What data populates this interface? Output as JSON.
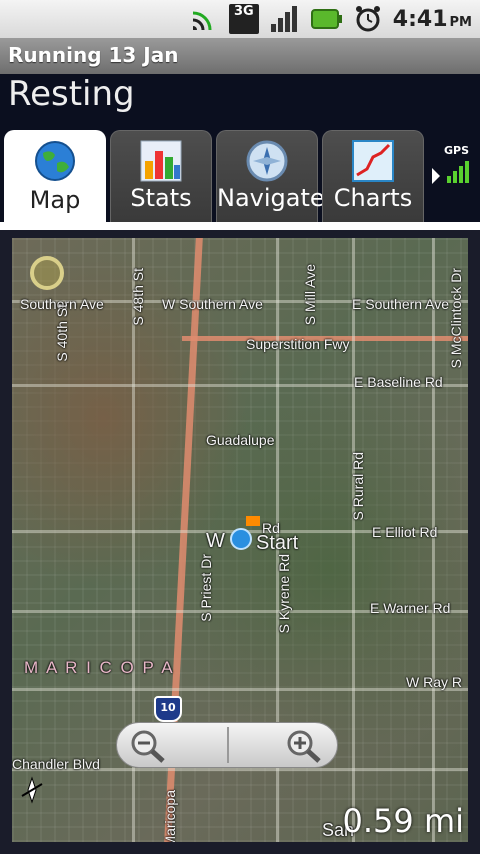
{
  "status_bar": {
    "network": "3G",
    "time": "4:41",
    "ampm": "PM"
  },
  "title_bar": {
    "title": "Running 13 Jan"
  },
  "header": {
    "state": "Resting"
  },
  "tabs": [
    {
      "label": "Map",
      "icon": "globe-icon",
      "active": true
    },
    {
      "label": "Stats",
      "icon": "bar-chart-icon",
      "active": false
    },
    {
      "label": "Navigate",
      "icon": "compass-icon",
      "active": false
    },
    {
      "label": "Charts",
      "icon": "line-chart-icon",
      "active": false
    }
  ],
  "gps": {
    "label": "GPS"
  },
  "map": {
    "labels": {
      "southern_ave_w": "Southern Ave",
      "w_southern_ave": "W Southern Ave",
      "e_southern_ave": "E Southern Ave",
      "superstition_fwy": "Superstition Fwy",
      "e_baseline_rd": "E Baseline Rd",
      "guadalupe": "Guadalupe",
      "e_elliot_rd": "E Elliot Rd",
      "e_warner_rd": "E Warner Rd",
      "w_ray_rd": "W Ray R",
      "chandler_blvd": "Chandler Blvd",
      "s_40th_st": "S 40th St",
      "s_48th_st": "S 48th St",
      "s_priest_dr": "S Priest Dr",
      "s_kyrene_rd": "S Kyrene Rd",
      "s_rural_rd": "S Rural Rd",
      "s_mill_ave": "S Mill Ave",
      "s_mcclintock_dr": "S McClintock Dr",
      "maricopa": "M A R I C O P A",
      "start": "Start",
      "w_elliot": "W",
      "rd": "Rd",
      "san": "San",
      "maricopa_road": "Maricopa"
    },
    "interstate": "10",
    "scale": "0.59 mi"
  }
}
